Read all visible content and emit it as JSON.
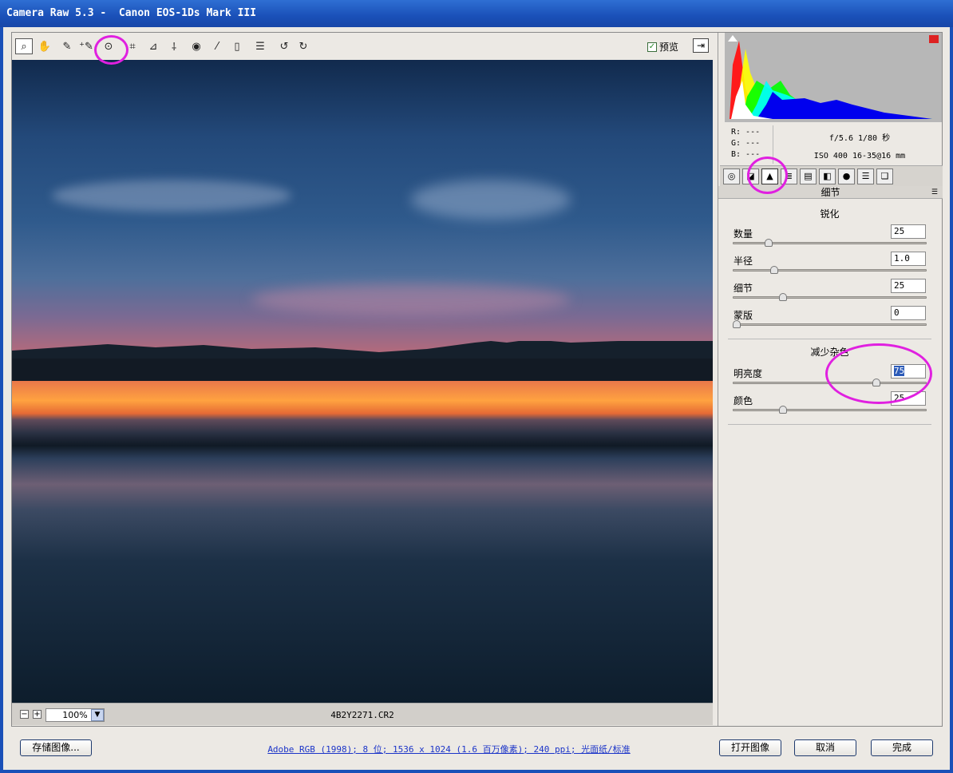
{
  "window": {
    "title": "Camera Raw 5.3 -  Canon EOS-1Ds Mark III"
  },
  "toolbar": {
    "tools": [
      {
        "name": "zoom-tool",
        "icon": "magnifier-icon",
        "glyph": "⌕"
      },
      {
        "name": "hand-tool",
        "icon": "hand-icon",
        "glyph": "✋"
      },
      {
        "name": "white-balance-tool",
        "icon": "eyedropper-icon",
        "glyph": "✎"
      },
      {
        "name": "color-sampler-tool",
        "icon": "color-sampler-icon",
        "glyph": "⁺✎"
      },
      {
        "name": "targeted-adjustment-tool",
        "icon": "target-icon",
        "glyph": "⊙"
      },
      {
        "name": "crop-tool",
        "icon": "crop-icon",
        "glyph": "⌗"
      },
      {
        "name": "straighten-tool",
        "icon": "straighten-icon",
        "glyph": "⊿"
      },
      {
        "name": "spot-removal-tool",
        "icon": "spot-removal-icon",
        "glyph": "⸸"
      },
      {
        "name": "red-eye-tool",
        "icon": "eye-icon",
        "glyph": "◉"
      },
      {
        "name": "adjustment-brush-tool",
        "icon": "brush-icon",
        "glyph": "⁄"
      },
      {
        "name": "graduated-filter-tool",
        "icon": "graduated-filter-icon",
        "glyph": "▯"
      },
      {
        "name": "preferences-tool",
        "icon": "list-icon",
        "glyph": "☰"
      },
      {
        "name": "rotate-left-tool",
        "icon": "rotate-ccw-icon",
        "glyph": "↺"
      },
      {
        "name": "rotate-right-tool",
        "icon": "rotate-cw-icon",
        "glyph": "↻"
      }
    ],
    "preview_label": "预览",
    "preview_checked": true
  },
  "image": {
    "zoom": "100%",
    "filename": "4B2Y2271.CR2"
  },
  "info": {
    "r": "R: ---",
    "g": "G: ---",
    "b": "B: ---",
    "exposure": "f/5.6  1/80 秒",
    "iso_lens": "ISO 400  16-35@16 mm"
  },
  "panel": {
    "title": "细节",
    "tabs": [
      "basic-tab",
      "tone-curve-tab",
      "detail-tab",
      "hsl-tab",
      "split-toning-tab",
      "lens-corrections-tab",
      "camera-calibration-tab",
      "presets-tab",
      "snapshots-tab"
    ],
    "active_tab": 2,
    "sharpening": {
      "title": "锐化",
      "sliders": [
        {
          "label": "数量",
          "value": "25",
          "fraction": 0.17
        },
        {
          "label": "半径",
          "value": "1.0",
          "fraction": 0.2
        },
        {
          "label": "细节",
          "value": "25",
          "fraction": 0.25
        },
        {
          "label": "蒙版",
          "value": "0",
          "fraction": 0.0
        }
      ]
    },
    "noise_reduction": {
      "title": "减少杂色",
      "sliders": [
        {
          "label": "明亮度",
          "value": "75",
          "fraction": 0.75
        },
        {
          "label": "颜色",
          "value": "25",
          "fraction": 0.25
        }
      ]
    }
  },
  "footer": {
    "save_label": "存储图像...",
    "workflow_link": "Adobe RGB (1998); 8 位; 1536 x 1024 (1.6 百万像素); 240 ppi; 光面纸/标准",
    "open_label": "打开图像",
    "cancel_label": "取消",
    "done_label": "完成"
  }
}
